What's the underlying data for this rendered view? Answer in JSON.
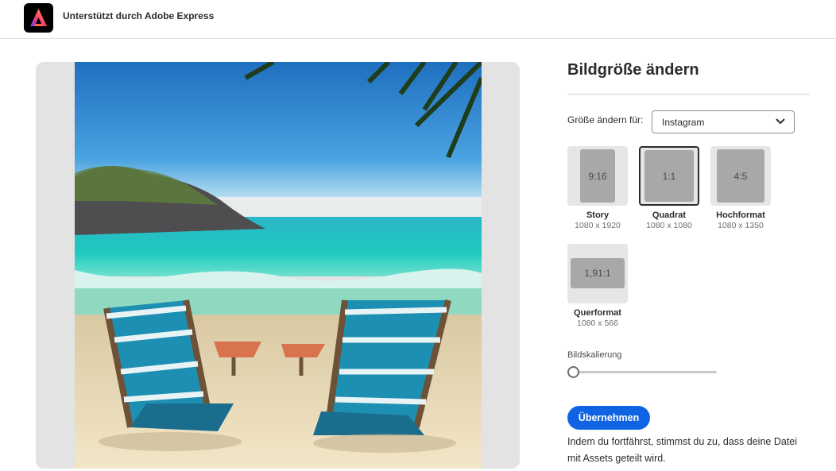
{
  "header": {
    "brand_text": "Unterstützt durch Adobe Express",
    "logo_icon": "adobe-express-logo"
  },
  "preview": {
    "image_subject": "beach-chairs-photo"
  },
  "panel": {
    "title": "Bildgröße ändern",
    "resize_for_label": "Größe ändern für:",
    "resize_for_value": "Instagram",
    "options": [
      {
        "ratio": "9:16",
        "name": "Story",
        "dims": "1080 x 1920",
        "selected": false
      },
      {
        "ratio": "1:1",
        "name": "Quadrat",
        "dims": "1080 x 1080",
        "selected": true
      },
      {
        "ratio": "4:5",
        "name": "Hochformat",
        "dims": "1080 x 1350",
        "selected": false
      },
      {
        "ratio": "1,91:1",
        "name": "Querformat",
        "dims": "1080 x 566",
        "selected": false
      }
    ],
    "scale_label": "Bildskalierung",
    "scale_value": 0,
    "apply_label": "Übernehmen",
    "notice": "Indem du fortfährst, stimmst du zu, dass deine Datei mit Assets geteilt wird."
  },
  "colors": {
    "accent": "#1064e3",
    "panel_bg": "#e3e3e3"
  }
}
